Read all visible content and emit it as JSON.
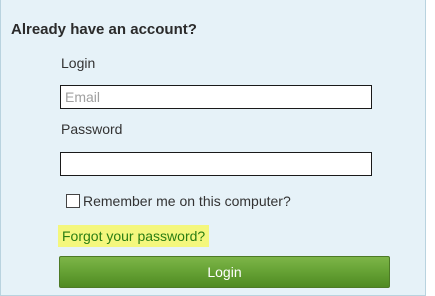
{
  "section": {
    "heading": "Already have an account?"
  },
  "login_form": {
    "login_label": "Login",
    "email_placeholder": "Email",
    "email_value": "",
    "password_label": "Password",
    "password_value": "",
    "remember_label": "Remember me on this computer?",
    "remember_checked": false,
    "forgot_link": "Forgot your password?",
    "submit_label": "Login"
  },
  "colors": {
    "panel_background": "#e6f2f8",
    "link_highlight": "#f4f77d",
    "link_text": "#2a7d12",
    "button_green": "#65a134"
  }
}
